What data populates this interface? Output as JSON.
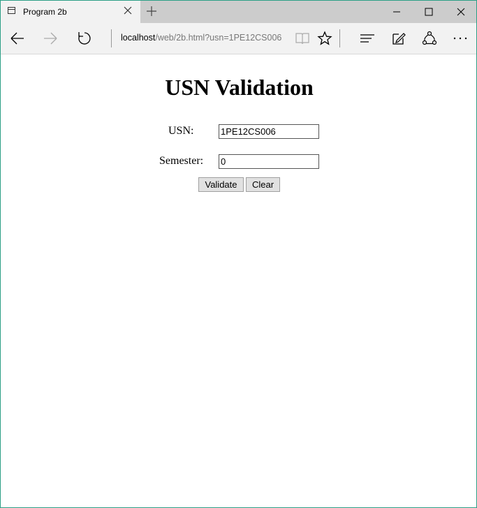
{
  "tab": {
    "title": "Program 2b"
  },
  "address": {
    "host": "localhost",
    "path": "/web/2b.html?usn=1PE12CS006"
  },
  "page": {
    "title": "USN Validation",
    "usn_label": "USN:",
    "usn_value": "1PE12CS006",
    "semester_label": "Semester:",
    "semester_value": "0",
    "validate_label": "Validate",
    "clear_label": "Clear"
  },
  "colors": {
    "window_border": "#2c9f86",
    "titlebar": "#cccccc",
    "toolbar": "#f2f2f2"
  }
}
